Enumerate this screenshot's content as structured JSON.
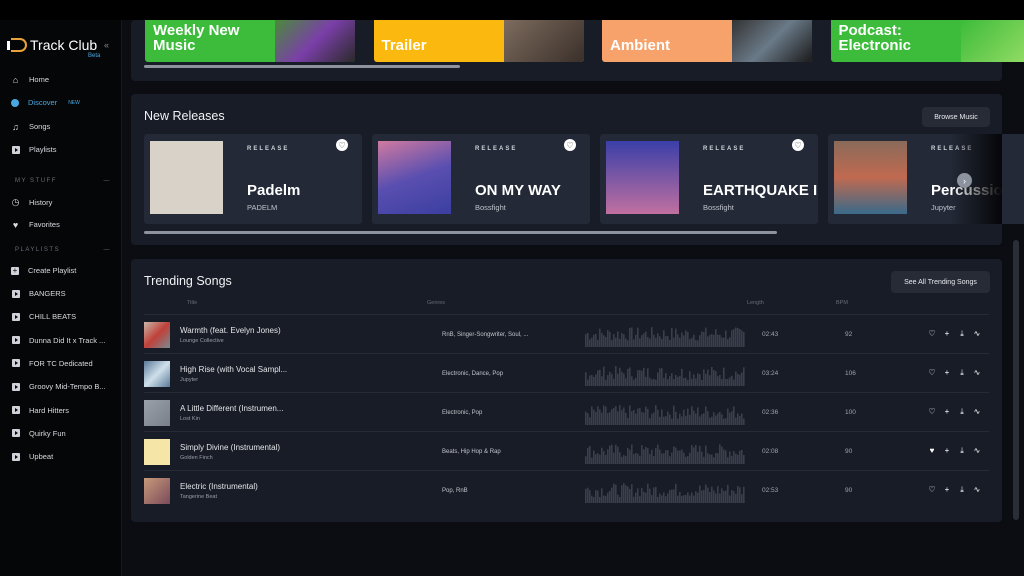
{
  "sidebar": {
    "app_name": "Track Club",
    "beta": "Beta",
    "collapse": "«",
    "nav": [
      {
        "label": "Home",
        "icon": "home-icon"
      },
      {
        "label": "Discover",
        "icon": "compass-icon",
        "badge": "NEW",
        "active": true
      },
      {
        "label": "Songs",
        "icon": "music-note-icon"
      },
      {
        "label": "Playlists",
        "icon": "playlist-icon"
      }
    ],
    "my_stuff_title": "MY STUFF",
    "my_stuff": [
      {
        "label": "History",
        "icon": "clock-icon"
      },
      {
        "label": "Favorites",
        "icon": "heart-icon"
      }
    ],
    "playlists_title": "PLAYLISTS",
    "create_playlist": "Create Playlist",
    "playlists": [
      "BANGERS",
      "CHILL BEATS",
      "Dunna Did It x Track ...",
      "FOR TC Dedicated",
      "Groovy Mid-Tempo B...",
      "Hard Hitters",
      "Quirky Fun",
      "Upbeat"
    ]
  },
  "banners": [
    {
      "title": "Weekly New Music",
      "color": "#3dbb3a"
    },
    {
      "title": "Trailer",
      "color": "#fbb90f"
    },
    {
      "title": "Ambient",
      "color": "#f7a26a"
    },
    {
      "title": "Podcast: Electronic",
      "color": "#3dbb3a"
    }
  ],
  "new_releases": {
    "title": "New Releases",
    "browse": "Browse Music",
    "items": [
      {
        "label": "RELEASE",
        "title": "Padelm",
        "artist": "PADELM"
      },
      {
        "label": "RELEASE",
        "title": "ON MY WAY",
        "artist": "Bossfight"
      },
      {
        "label": "RELEASE",
        "title": "EARTHQUAKE I...",
        "artist": "Bossfight"
      },
      {
        "label": "RELEASE",
        "title": "Percussio",
        "artist": "Jupyter"
      }
    ]
  },
  "trending": {
    "title": "Trending Songs",
    "see_all": "See All Trending Songs",
    "columns": {
      "title": "Title",
      "genres": "Genres",
      "length": "Length",
      "bpm": "BPM"
    },
    "rows": [
      {
        "title": "Warmth (feat. Evelyn Jones)",
        "artist": "Lounge Collective",
        "genres": "RnB, Singer-Songwriter, Soul, ...",
        "length": "02:43",
        "bpm": "92",
        "favorited": false
      },
      {
        "title": "High Rise (with Vocal Sampl...",
        "artist": "Jupyter",
        "genres": "Electronic, Dance, Pop",
        "length": "03:24",
        "bpm": "106",
        "favorited": false
      },
      {
        "title": "A Little Different (Instrumen...",
        "artist": "Lost Kin",
        "genres": "Electronic, Pop",
        "length": "02:36",
        "bpm": "100",
        "favorited": false
      },
      {
        "title": "Simply Divine (Instrumental)",
        "artist": "Golden Finch",
        "genres": "Beats, Hip Hop & Rap",
        "length": "02:08",
        "bpm": "90",
        "favorited": true
      },
      {
        "title": "Electric (Instrumental)",
        "artist": "Tangerine Beat",
        "genres": "Pop, RnB",
        "length": "02:53",
        "bpm": "90",
        "favorited": false
      }
    ]
  }
}
